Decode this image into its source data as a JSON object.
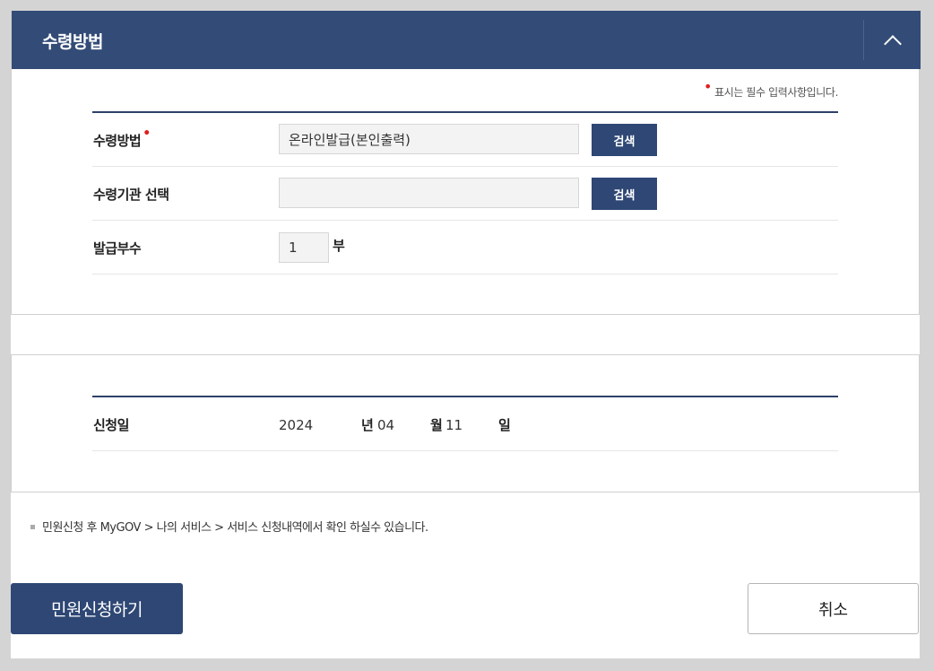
{
  "section1": {
    "title": "수령방법",
    "toggle_icon": "chevron-up-icon",
    "required_note": "표시는 필수 입력사항입니다.",
    "required_color": "#e01e1e",
    "rows": [
      {
        "label": "수령방법",
        "value": "온라인발급(본인출력)",
        "button": "검색"
      },
      {
        "label": "수령기관 선택",
        "value": "",
        "button": "검색"
      },
      {
        "label": "발급부수",
        "value": "1",
        "unit": "부"
      }
    ]
  },
  "section2": {
    "date_label": "신청일",
    "year": "2024",
    "year_unit": "년",
    "month": "04",
    "month_unit": "월",
    "day": "11",
    "day_unit": "일"
  },
  "info_note": "민원신청 후 MyGOV > 나의 서비스 > 서비스 신청내역에서 확인 하실수 있습니다.",
  "actions": {
    "submit_label": "민원신청하기",
    "cancel_label": "취소"
  },
  "colors": {
    "header_bg": "#334b77",
    "button_bg": "#2e4774"
  }
}
